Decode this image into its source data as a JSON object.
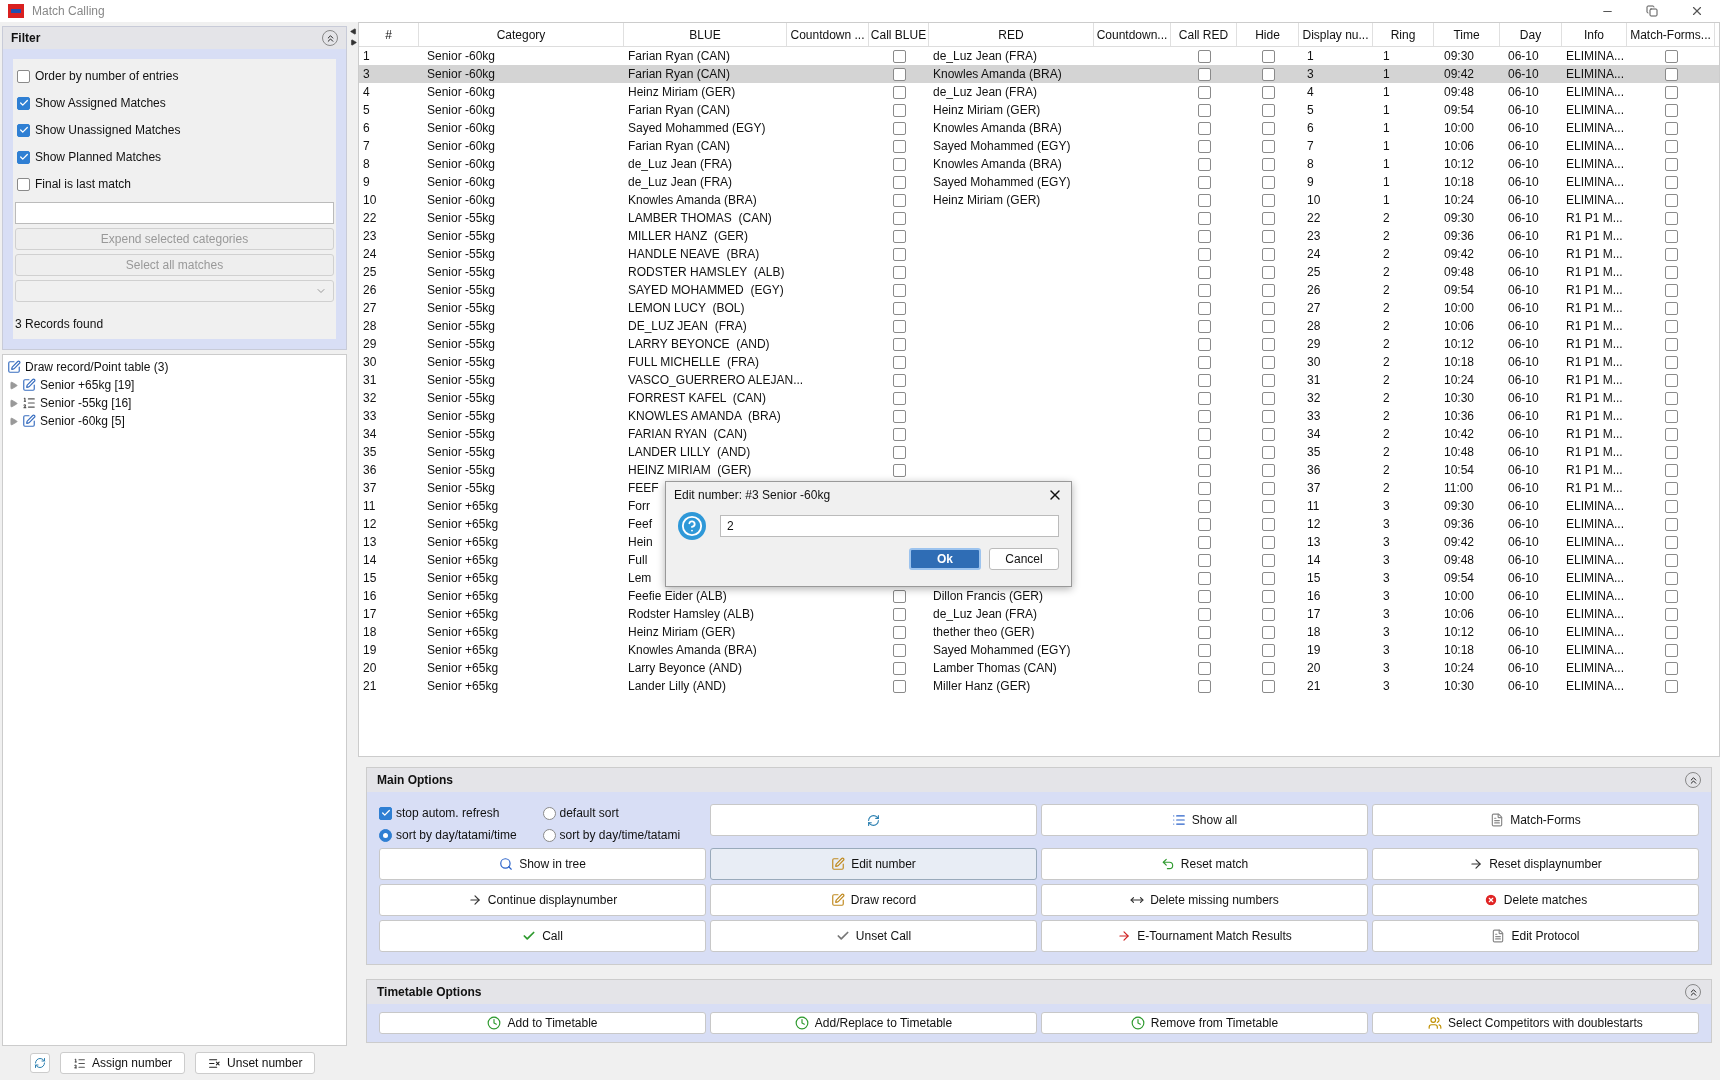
{
  "window": {
    "title": "Match Calling"
  },
  "filter": {
    "title": "Filter",
    "options": [
      {
        "label": "Order by number of entries",
        "checked": false
      },
      {
        "label": "Show Assigned Matches",
        "checked": true
      },
      {
        "label": "Show Unassigned Matches",
        "checked": true
      },
      {
        "label": "Show Planned Matches",
        "checked": true
      },
      {
        "label": "Final is last match",
        "checked": false
      }
    ],
    "buttons": [
      {
        "label": "Expend selected categories",
        "disabled": true
      },
      {
        "label": "Select all matches",
        "disabled": true
      }
    ],
    "records": "3 Records found"
  },
  "tree": {
    "label": "Draw record/Point table (3)",
    "children": [
      {
        "label": "Senior +65kg [19]",
        "expanded": false
      },
      {
        "label": "Senior -55kg [16]",
        "expanded": false
      },
      {
        "label": "Senior -60kg [5]",
        "expanded": false
      }
    ]
  },
  "left_buttons": [
    "Assign number",
    "Unset number"
  ],
  "table": {
    "columns": [
      "#",
      "Category",
      "BLUE",
      "Countdown ...",
      "Call BLUE",
      "RED",
      "Countdown...",
      "Call RED",
      "Hide",
      "Display nu...",
      "Ring",
      "Time",
      "Day",
      "Info",
      "Match-Forms..."
    ],
    "rows": [
      {
        "num": "1",
        "category": "Senior -60kg",
        "blue": "Farian Ryan (CAN)",
        "call_blue": false,
        "red": "de_Luz Jean (FRA)",
        "call_red": false,
        "hide": false,
        "display": "1",
        "ring": "1",
        "time": "09:30",
        "day": "06-10",
        "info": "ELIMINA...",
        "forms": false,
        "selected": false
      },
      {
        "num": "3",
        "category": "Senior -60kg",
        "blue": "Farian Ryan (CAN)",
        "call_blue": false,
        "red": "Knowles Amanda (BRA)",
        "call_red": false,
        "hide": false,
        "display": "3",
        "ring": "1",
        "time": "09:42",
        "day": "06-10",
        "info": "ELIMINA...",
        "forms": false,
        "selected": true
      },
      {
        "num": "4",
        "category": "Senior -60kg",
        "blue": "Heinz Miriam (GER)",
        "call_blue": false,
        "red": "de_Luz Jean (FRA)",
        "call_red": false,
        "hide": false,
        "display": "4",
        "ring": "1",
        "time": "09:48",
        "day": "06-10",
        "info": "ELIMINA...",
        "forms": false,
        "selected": false
      },
      {
        "num": "5",
        "category": "Senior -60kg",
        "blue": "Farian Ryan (CAN)",
        "call_blue": false,
        "red": "Heinz Miriam (GER)",
        "call_red": false,
        "hide": false,
        "display": "5",
        "ring": "1",
        "time": "09:54",
        "day": "06-10",
        "info": "ELIMINA...",
        "forms": false,
        "selected": false
      },
      {
        "num": "6",
        "category": "Senior -60kg",
        "blue": "Sayed Mohammed (EGY)",
        "call_blue": false,
        "red": "Knowles Amanda (BRA)",
        "call_red": false,
        "hide": false,
        "display": "6",
        "ring": "1",
        "time": "10:00",
        "day": "06-10",
        "info": "ELIMINA...",
        "forms": false,
        "selected": false
      },
      {
        "num": "7",
        "category": "Senior -60kg",
        "blue": "Farian Ryan (CAN)",
        "call_blue": false,
        "red": "Sayed Mohammed (EGY)",
        "call_red": false,
        "hide": false,
        "display": "7",
        "ring": "1",
        "time": "10:06",
        "day": "06-10",
        "info": "ELIMINA...",
        "forms": false,
        "selected": false
      },
      {
        "num": "8",
        "category": "Senior -60kg",
        "blue": "de_Luz Jean (FRA)",
        "call_blue": false,
        "red": "Knowles Amanda (BRA)",
        "call_red": false,
        "hide": false,
        "display": "8",
        "ring": "1",
        "time": "10:12",
        "day": "06-10",
        "info": "ELIMINA...",
        "forms": false,
        "selected": false
      },
      {
        "num": "9",
        "category": "Senior -60kg",
        "blue": "de_Luz Jean (FRA)",
        "call_blue": false,
        "red": "Sayed Mohammed (EGY)",
        "call_red": false,
        "hide": false,
        "display": "9",
        "ring": "1",
        "time": "10:18",
        "day": "06-10",
        "info": "ELIMINA...",
        "forms": false,
        "selected": false
      },
      {
        "num": "10",
        "category": "Senior -60kg",
        "blue": "Knowles Amanda (BRA)",
        "call_blue": false,
        "red": "Heinz Miriam (GER)",
        "call_red": false,
        "hide": false,
        "display": "10",
        "ring": "1",
        "time": "10:24",
        "day": "06-10",
        "info": "ELIMINA...",
        "forms": false,
        "selected": false
      },
      {
        "num": "22",
        "category": "Senior -55kg",
        "blue": "LAMBER THOMAS  (CAN)",
        "call_blue": false,
        "call_red": false,
        "hide": false,
        "display": "22",
        "ring": "2",
        "time": "09:30",
        "day": "06-10",
        "info": "R1 P1 M...",
        "forms": false,
        "selected": false
      },
      {
        "num": "23",
        "category": "Senior -55kg",
        "blue": "MILLER HANZ  (GER)",
        "call_blue": false,
        "call_red": false,
        "hide": false,
        "display": "23",
        "ring": "2",
        "time": "09:36",
        "day": "06-10",
        "info": "R1 P1 M...",
        "forms": false,
        "selected": false
      },
      {
        "num": "24",
        "category": "Senior -55kg",
        "blue": "HANDLE NEAVE  (BRA)",
        "call_blue": false,
        "call_red": false,
        "hide": false,
        "display": "24",
        "ring": "2",
        "time": "09:42",
        "day": "06-10",
        "info": "R1 P1 M...",
        "forms": false,
        "selected": false
      },
      {
        "num": "25",
        "category": "Senior -55kg",
        "blue": "RODSTER HAMSLEY  (ALB)",
        "call_blue": false,
        "call_red": false,
        "hide": false,
        "display": "25",
        "ring": "2",
        "time": "09:48",
        "day": "06-10",
        "info": "R1 P1 M...",
        "forms": false,
        "selected": false
      },
      {
        "num": "26",
        "category": "Senior -55kg",
        "blue": "SAYED MOHAMMED  (EGY)",
        "call_blue": false,
        "call_red": false,
        "hide": false,
        "display": "26",
        "ring": "2",
        "time": "09:54",
        "day": "06-10",
        "info": "R1 P1 M...",
        "forms": false,
        "selected": false
      },
      {
        "num": "27",
        "category": "Senior -55kg",
        "blue": "LEMON LUCY  (BOL)",
        "call_blue": false,
        "call_red": false,
        "hide": false,
        "display": "27",
        "ring": "2",
        "time": "10:00",
        "day": "06-10",
        "info": "R1 P1 M...",
        "forms": false,
        "selected": false
      },
      {
        "num": "28",
        "category": "Senior -55kg",
        "blue": "DE_LUZ JEAN  (FRA)",
        "call_blue": false,
        "call_red": false,
        "hide": false,
        "display": "28",
        "ring": "2",
        "time": "10:06",
        "day": "06-10",
        "info": "R1 P1 M...",
        "forms": false,
        "selected": false
      },
      {
        "num": "29",
        "category": "Senior -55kg",
        "blue": "LARRY BEYONCE  (AND)",
        "call_blue": false,
        "call_red": false,
        "hide": false,
        "display": "29",
        "ring": "2",
        "time": "10:12",
        "day": "06-10",
        "info": "R1 P1 M...",
        "forms": false,
        "selected": false
      },
      {
        "num": "30",
        "category": "Senior -55kg",
        "blue": "FULL MICHELLE  (FRA)",
        "call_blue": false,
        "call_red": false,
        "hide": false,
        "display": "30",
        "ring": "2",
        "time": "10:18",
        "day": "06-10",
        "info": "R1 P1 M...",
        "forms": false,
        "selected": false
      },
      {
        "num": "31",
        "category": "Senior -55kg",
        "blue": "VASCO_GUERRERO ALEJAN...",
        "call_blue": false,
        "call_red": false,
        "hide": false,
        "display": "31",
        "ring": "2",
        "time": "10:24",
        "day": "06-10",
        "info": "R1 P1 M...",
        "forms": false,
        "selected": false
      },
      {
        "num": "32",
        "category": "Senior -55kg",
        "blue": "FORREST KAFEL  (CAN)",
        "call_blue": false,
        "call_red": false,
        "hide": false,
        "display": "32",
        "ring": "2",
        "time": "10:30",
        "day": "06-10",
        "info": "R1 P1 M...",
        "forms": false,
        "selected": false
      },
      {
        "num": "33",
        "category": "Senior -55kg",
        "blue": "KNOWLES AMANDA  (BRA)",
        "call_blue": false,
        "call_red": false,
        "hide": false,
        "display": "33",
        "ring": "2",
        "time": "10:36",
        "day": "06-10",
        "info": "R1 P1 M...",
        "forms": false,
        "selected": false
      },
      {
        "num": "34",
        "category": "Senior -55kg",
        "blue": "FARIAN RYAN  (CAN)",
        "call_blue": false,
        "call_red": false,
        "hide": false,
        "display": "34",
        "ring": "2",
        "time": "10:42",
        "day": "06-10",
        "info": "R1 P1 M...",
        "forms": false,
        "selected": false
      },
      {
        "num": "35",
        "category": "Senior -55kg",
        "blue": "LANDER LILLY  (AND)",
        "call_blue": false,
        "call_red": false,
        "hide": false,
        "display": "35",
        "ring": "2",
        "time": "10:48",
        "day": "06-10",
        "info": "R1 P1 M...",
        "forms": false,
        "selected": false
      },
      {
        "num": "36",
        "category": "Senior -55kg",
        "blue": "HEINZ MIRIAM  (GER)",
        "call_blue": false,
        "call_red": false,
        "hide": false,
        "display": "36",
        "ring": "2",
        "time": "10:54",
        "day": "06-10",
        "info": "R1 P1 M...",
        "forms": false,
        "selected": false
      },
      {
        "num": "37",
        "category": "Senior -55kg",
        "blue": "FEEF",
        "call_red": false,
        "hide": false,
        "display": "37",
        "ring": "2",
        "time": "11:00",
        "day": "06-10",
        "info": "R1 P1 M...",
        "forms": false,
        "selected": false
      },
      {
        "num": "11",
        "category": "Senior +65kg",
        "blue": "Forr",
        "call_red": false,
        "hide": false,
        "display": "11",
        "ring": "3",
        "time": "09:30",
        "day": "06-10",
        "info": "ELIMINA...",
        "forms": false,
        "selected": false
      },
      {
        "num": "12",
        "category": "Senior +65kg",
        "blue": "Feef",
        "call_red": false,
        "hide": false,
        "display": "12",
        "ring": "3",
        "time": "09:36",
        "day": "06-10",
        "info": "ELIMINA...",
        "forms": false,
        "selected": false
      },
      {
        "num": "13",
        "category": "Senior +65kg",
        "blue": "Hein",
        "call_red": false,
        "hide": false,
        "display": "13",
        "ring": "3",
        "time": "09:42",
        "day": "06-10",
        "info": "ELIMINA...",
        "forms": false,
        "selected": false
      },
      {
        "num": "14",
        "category": "Senior +65kg",
        "blue": "Full",
        "call_red": false,
        "hide": false,
        "display": "14",
        "ring": "3",
        "time": "09:48",
        "day": "06-10",
        "info": "ELIMINA...",
        "forms": false,
        "selected": false
      },
      {
        "num": "15",
        "category": "Senior +65kg",
        "blue": "Lem",
        "call_red": false,
        "hide": false,
        "display": "15",
        "ring": "3",
        "time": "09:54",
        "day": "06-10",
        "info": "ELIMINA...",
        "forms": false,
        "selected": false
      },
      {
        "num": "16",
        "category": "Senior +65kg",
        "blue": "Feefie Eider (ALB)",
        "call_blue": false,
        "red": "Dillon Francis (GER)",
        "call_red": false,
        "hide": false,
        "display": "16",
        "ring": "3",
        "time": "10:00",
        "day": "06-10",
        "info": "ELIMINA...",
        "forms": false,
        "selected": false
      },
      {
        "num": "17",
        "category": "Senior +65kg",
        "blue": "Rodster Hamsley (ALB)",
        "call_blue": false,
        "red": "de_Luz Jean (FRA)",
        "call_red": false,
        "hide": false,
        "display": "17",
        "ring": "3",
        "time": "10:06",
        "day": "06-10",
        "info": "ELIMINA...",
        "forms": false,
        "selected": false
      },
      {
        "num": "18",
        "category": "Senior +65kg",
        "blue": "Heinz Miriam (GER)",
        "call_blue": false,
        "red": "thether theo (GER)",
        "call_red": false,
        "hide": false,
        "display": "18",
        "ring": "3",
        "time": "10:12",
        "day": "06-10",
        "info": "ELIMINA...",
        "forms": false,
        "selected": false
      },
      {
        "num": "19",
        "category": "Senior +65kg",
        "blue": "Knowles Amanda (BRA)",
        "call_blue": false,
        "red": "Sayed Mohammed (EGY)",
        "call_red": false,
        "hide": false,
        "display": "19",
        "ring": "3",
        "time": "10:18",
        "day": "06-10",
        "info": "ELIMINA...",
        "forms": false,
        "selected": false
      },
      {
        "num": "20",
        "category": "Senior +65kg",
        "blue": "Larry Beyonce (AND)",
        "call_blue": false,
        "red": "Lamber Thomas (CAN)",
        "call_red": false,
        "hide": false,
        "display": "20",
        "ring": "3",
        "time": "10:24",
        "day": "06-10",
        "info": "ELIMINA...",
        "forms": false,
        "selected": false
      },
      {
        "num": "21",
        "category": "Senior +65kg",
        "blue": "Lander Lilly (AND)",
        "call_blue": false,
        "red": "Miller Hanz (GER)",
        "call_red": false,
        "hide": false,
        "display": "21",
        "ring": "3",
        "time": "10:30",
        "day": "06-10",
        "info": "ELIMINA...",
        "forms": false,
        "selected": false
      }
    ]
  },
  "main_options": {
    "title": "Main Options",
    "expanded": true,
    "settings": [
      {
        "kind": "checkbox",
        "label": "stop autom. refresh",
        "checked": true
      },
      {
        "kind": "radio",
        "label": "default sort",
        "selected": false
      },
      {
        "kind": "radio",
        "label": "sort by day/tatami/time",
        "selected": true
      },
      {
        "kind": "radio",
        "label": "sort by day/time/tatami",
        "selected": false
      }
    ],
    "buttons": [
      {
        "label": "Show all",
        "focused": false
      },
      {
        "label": "Match-Forms",
        "focused": false
      },
      {
        "label": "Show in tree",
        "focused": false
      },
      {
        "label": "Edit number",
        "focused": true
      },
      {
        "label": "Reset match",
        "focused": false
      },
      {
        "label": "Reset displaynumber",
        "focused": false
      },
      {
        "label": "Continue displaynumber",
        "focused": false
      },
      {
        "label": "Draw record",
        "focused": false
      },
      {
        "label": "Delete missing numbers",
        "focused": false
      },
      {
        "label": "Delete matches",
        "focused": false
      },
      {
        "label": "Call",
        "focused": false
      },
      {
        "label": "Unset Call",
        "focused": false
      },
      {
        "label": "E-Tournament Match Results",
        "focused": false
      },
      {
        "label": "Edit Protocol",
        "focused": false
      }
    ]
  },
  "timetable_options": {
    "title": "Timetable Options",
    "expanded": true,
    "buttons": [
      "Add to Timetable",
      "Add/Replace to Timetable",
      "Remove from Timetable",
      "Select Competitors with doublestarts"
    ]
  },
  "dialog": {
    "title": "Edit number: #3 Senior -60kg",
    "value": "2",
    "ok": "Ok",
    "cancel": "Cancel"
  }
}
